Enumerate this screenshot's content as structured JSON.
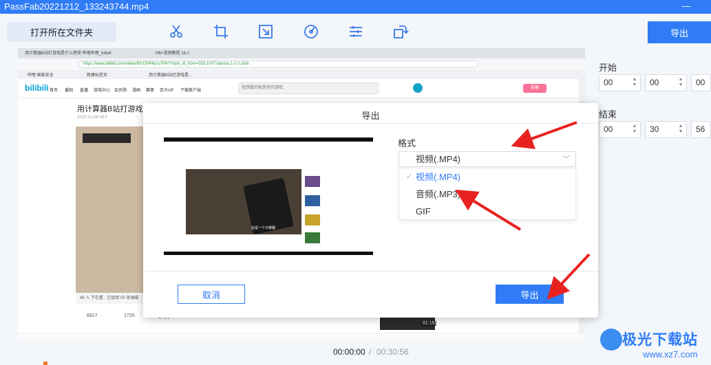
{
  "window": {
    "title": "PassFab20221212_133243744.mp4",
    "minimize_icon": "minimize-icon"
  },
  "toolbar": {
    "open_folder_label": "打开所在文件夹",
    "tools": [
      "scissors-icon",
      "crop-icon",
      "resize-icon",
      "speed-icon",
      "adjust-icon",
      "rotate-icon"
    ],
    "export_label": "导出"
  },
  "browser": {
    "tabs_top": [
      "用计算器B站打游戏是什么感受 哔哩哔哩_bilibili",
      "MM 视频教程 18.1"
    ],
    "url": "https://www.bilibili.com/video/BV1SW4y1u7MV/?spm_id_from=333.1007.tianma.1-2-2.click",
    "tabs_second": [
      "哔哩 国家安全",
      "新建标签页",
      "用计算器B站打游戏是..."
    ],
    "logo": "bilibili",
    "nav_items": [
      "首页",
      "番剧",
      "直播",
      "游戏中心",
      "会员购",
      "漫画",
      "赛事",
      "百大UP",
      "下载客户端"
    ],
    "search_placeholder": "我想看的就是你的游戏",
    "upload_label": "投稿",
    "video_title": "用计算器B站打游戏是什么感受",
    "video_meta": "2022-12-08 16:0",
    "video_caption": "46 人 下在看 · 已读到 00 条弹幕",
    "action_counts": [
      "6817",
      "1720",
      "1.4万",
      "160"
    ],
    "side_tag": "01:15",
    "thumb_caption": "这是一个计算器"
  },
  "right_panel": {
    "start_label": "开始",
    "end_label": "结束",
    "start": [
      "00",
      "00",
      "00"
    ],
    "end": [
      "00",
      "30",
      "56"
    ]
  },
  "timebar": {
    "current": "00:00:00",
    "separator": "/",
    "total": "00:30:56"
  },
  "modal": {
    "title": "导出",
    "format_label": "格式",
    "selected": "视频(.MP4)",
    "options": [
      "视频(.MP4)",
      "音频(.MP3)",
      "GIF"
    ],
    "cancel_label": "取消",
    "export_label": "导出"
  },
  "watermark": {
    "text": "极光下载站",
    "url": "www.xz7.com"
  },
  "colors": {
    "accent": "#2f7cf6",
    "arrow": "#e8231f",
    "panel_bg": "#f3f6fb"
  }
}
